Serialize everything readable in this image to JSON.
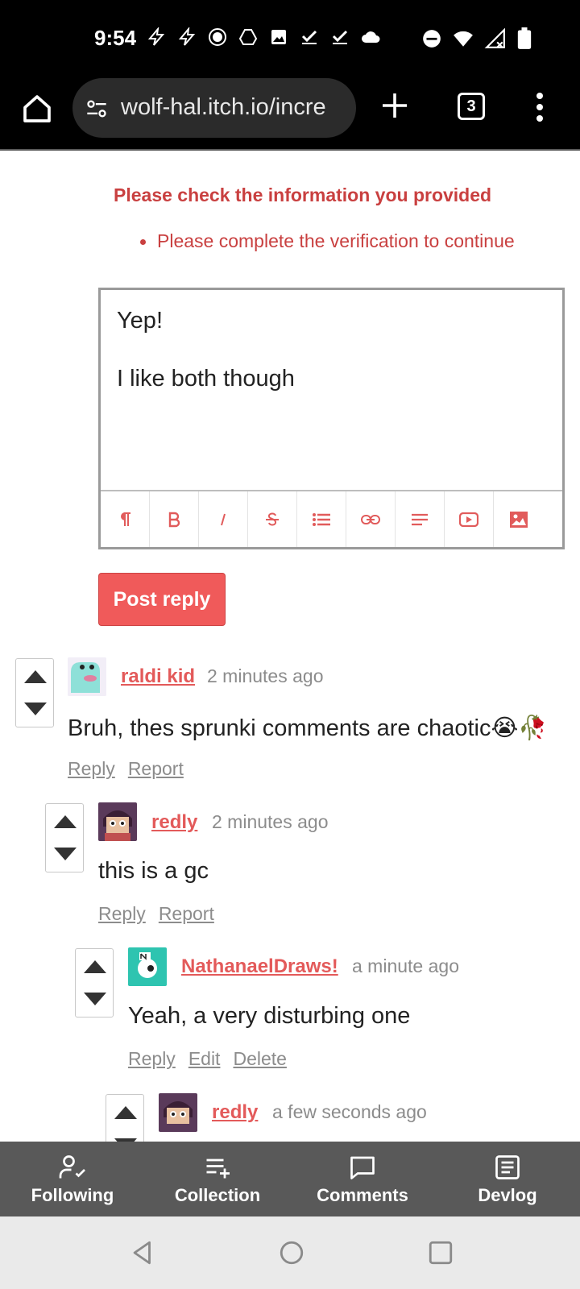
{
  "status": {
    "time": "9:54"
  },
  "browser": {
    "url": "wolf-hal.itch.io/incre",
    "tab_count": "3"
  },
  "form": {
    "error_title": "Please check the information you provided",
    "error_item": "Please complete the verification to continue",
    "editor_lines": [
      "Yep!",
      "I like both though"
    ],
    "post_button": "Post reply"
  },
  "comments": [
    {
      "username": "raldi kid",
      "time": "2 minutes ago",
      "body": "Bruh, thes sprunki comments are chaotic😭🥀",
      "links": [
        "Reply",
        "Report"
      ]
    },
    {
      "username": "redly",
      "time": "2 minutes ago",
      "body": "this is a gc",
      "links": [
        "Reply",
        "Report"
      ]
    },
    {
      "username": "NathanaelDraws!",
      "time": "a minute ago",
      "body": "Yeah, a very disturbing one",
      "links": [
        "Reply",
        "Edit",
        "Delete"
      ]
    },
    {
      "username": "redly",
      "time": "a few seconds ago"
    }
  ],
  "bottom_nav": {
    "items": [
      {
        "label": "Following",
        "icon": "user-check-icon"
      },
      {
        "label": "Collection",
        "icon": "playlist-add-icon"
      },
      {
        "label": "Comments",
        "icon": "comment-icon"
      },
      {
        "label": "Devlog",
        "icon": "article-icon"
      }
    ]
  },
  "colors": {
    "accent": "#f05a5a",
    "error": "#c94040",
    "link": "#e35a5a"
  }
}
